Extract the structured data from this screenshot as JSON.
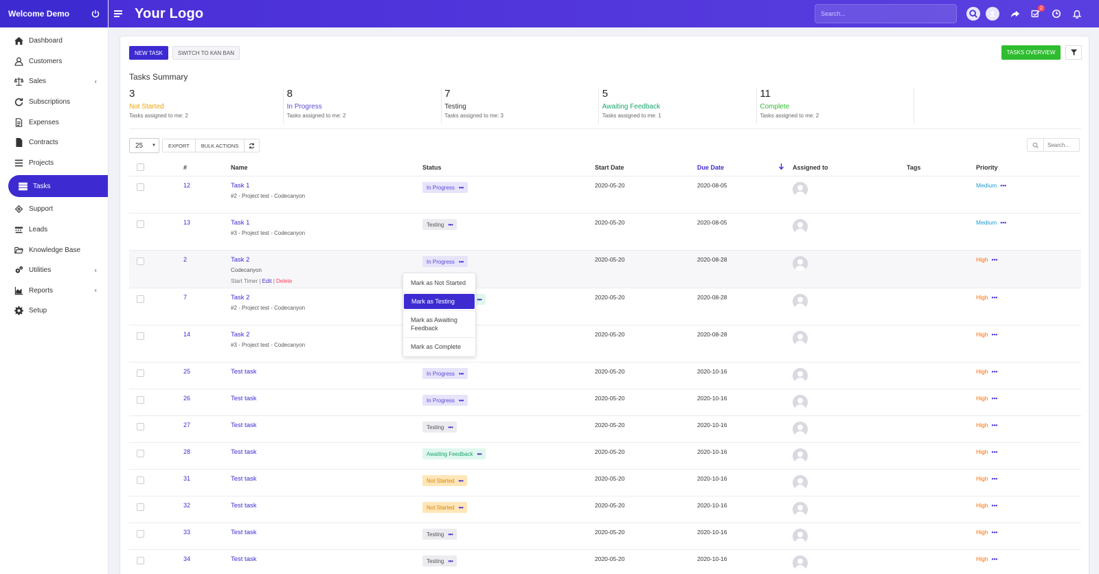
{
  "sidebar": {
    "welcome": "Welcome Demo",
    "items": [
      {
        "label": "Dashboard",
        "icon": "home-icon"
      },
      {
        "label": "Customers",
        "icon": "user-icon"
      },
      {
        "label": "Sales",
        "icon": "balance-scale-icon",
        "chevron": true
      },
      {
        "label": "Subscriptions",
        "icon": "refresh-icon"
      },
      {
        "label": "Expenses",
        "icon": "file-icon"
      },
      {
        "label": "Contracts",
        "icon": "document-icon"
      },
      {
        "label": "Projects",
        "icon": "bars-icon"
      },
      {
        "label": "Tasks",
        "icon": "tasks-icon",
        "active": true
      },
      {
        "label": "Support",
        "icon": "ticket-icon"
      },
      {
        "label": "Leads",
        "icon": "tty-icon"
      },
      {
        "label": "Knowledge Base",
        "icon": "folder-open-icon"
      },
      {
        "label": "Utilities",
        "icon": "cogs-icon",
        "chevron": true
      },
      {
        "label": "Reports",
        "icon": "area-chart-icon",
        "chevron": true
      },
      {
        "label": "Setup",
        "icon": "gear-icon"
      }
    ]
  },
  "topbar": {
    "logo": "Your Logo",
    "search_placeholder": "Search...",
    "tasks_badge": "2",
    "accent": "#3d2bd1"
  },
  "toolbar": {
    "new_task": "NEW TASK",
    "switch_kanban": "SWITCH TO KAN BAN",
    "tasks_overview": "TASKS OVERVIEW"
  },
  "summary": {
    "title": "Tasks Summary",
    "items": [
      {
        "count": "3",
        "label": "Not Started",
        "sub": "Tasks assigned to me: 2",
        "color": "#f0a30a"
      },
      {
        "count": "8",
        "label": "In Progress",
        "sub": "Tasks assigned to me: 2",
        "color": "#5b49d8"
      },
      {
        "count": "7",
        "label": "Testing",
        "sub": "Tasks assigned to me: 3",
        "color": "#333333"
      },
      {
        "count": "5",
        "label": "Awaiting Feedback",
        "sub": "Tasks assigned to me: 1",
        "color": "#19a56b"
      },
      {
        "count": "11",
        "label": "Complete",
        "sub": "Tasks assigned to me: 2",
        "color": "#2ebd2e"
      }
    ]
  },
  "table_controls": {
    "page_length": "25",
    "export": "EXPORT",
    "bulk_actions": "BULK ACTIONS",
    "search_placeholder": "Search..."
  },
  "columns": {
    "id": "#",
    "name": "Name",
    "status": "Status",
    "start": "Start Date",
    "due": "Due Date",
    "assigned": "Assigned to",
    "tags": "Tags",
    "priority": "Priority"
  },
  "rows": [
    {
      "id": "12",
      "name": "Task 1",
      "sub": "#2 - Project test - Codecanyon",
      "status": "In Progress",
      "skind": "progress",
      "start": "2020-05-20",
      "due": "2020-08-05",
      "priority": "Medium",
      "pkind": "medium"
    },
    {
      "id": "13",
      "name": "Task 1",
      "sub": "#3 - Project test - Codecanyon",
      "status": "Testing",
      "skind": "testing",
      "start": "2020-05-20",
      "due": "2020-08-05",
      "priority": "Medium",
      "pkind": "medium"
    },
    {
      "id": "2",
      "name": "Task 2",
      "sub": "Codecanyon",
      "status": "In Progress",
      "skind": "progress",
      "start": "2020-05-20",
      "due": "2020-08-28",
      "priority": "High",
      "pkind": "high",
      "hover": true
    },
    {
      "id": "7",
      "name": "Task 2",
      "sub": "#2 - Project test - Codecanyon",
      "status": "Awaiting Feedback",
      "skind": "feedback",
      "start": "2020-05-20",
      "due": "2020-08-28",
      "priority": "High",
      "pkind": "high"
    },
    {
      "id": "14",
      "name": "Task 2",
      "sub": "#3 - Project test - Codecanyon",
      "status": "In Progress",
      "skind": "progress",
      "start": "2020-05-20",
      "due": "2020-08-28",
      "priority": "High",
      "pkind": "high"
    },
    {
      "id": "25",
      "name": "Test task",
      "sub": "",
      "status": "In Progress",
      "skind": "progress",
      "start": "2020-05-20",
      "due": "2020-10-16",
      "priority": "High",
      "pkind": "high"
    },
    {
      "id": "26",
      "name": "Test task",
      "sub": "",
      "status": "In Progress",
      "skind": "progress",
      "start": "2020-05-20",
      "due": "2020-10-16",
      "priority": "High",
      "pkind": "high"
    },
    {
      "id": "27",
      "name": "Test task",
      "sub": "",
      "status": "Testing",
      "skind": "testing",
      "start": "2020-05-20",
      "due": "2020-10-16",
      "priority": "High",
      "pkind": "high"
    },
    {
      "id": "28",
      "name": "Test task",
      "sub": "",
      "status": "Awaiting Feedback",
      "skind": "feedback",
      "start": "2020-05-20",
      "due": "2020-10-16",
      "priority": "High",
      "pkind": "high"
    },
    {
      "id": "31",
      "name": "Test task",
      "sub": "",
      "status": "Not Started",
      "skind": "notstarted",
      "start": "2020-05-20",
      "due": "2020-10-16",
      "priority": "High",
      "pkind": "high"
    },
    {
      "id": "32",
      "name": "Test task",
      "sub": "",
      "status": "Not Started",
      "skind": "notstarted",
      "start": "2020-05-20",
      "due": "2020-10-16",
      "priority": "High",
      "pkind": "high"
    },
    {
      "id": "33",
      "name": "Test task",
      "sub": "",
      "status": "Testing",
      "skind": "testing",
      "start": "2020-05-20",
      "due": "2020-10-16",
      "priority": "High",
      "pkind": "high"
    },
    {
      "id": "34",
      "name": "Test task",
      "sub": "",
      "status": "Testing",
      "skind": "testing",
      "start": "2020-05-20",
      "due": "2020-10-16",
      "priority": "High",
      "pkind": "high"
    }
  ],
  "hover_actions": {
    "start_timer": "Start Timer",
    "edit": "Edit",
    "delete": "Delete",
    "sep": "|"
  },
  "status_dropdown": [
    {
      "label": "Mark as Not Started"
    },
    {
      "label": "Mark as Testing",
      "active": true
    },
    {
      "label": "Mark as Awaiting Feedback"
    },
    {
      "label": "Mark as Complete"
    }
  ]
}
